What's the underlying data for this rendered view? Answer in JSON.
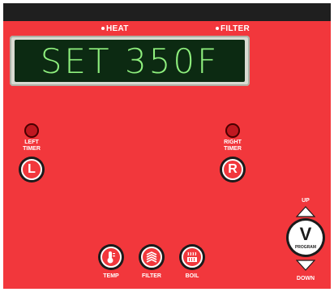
{
  "indicators": {
    "heat": "HEAT",
    "filter": "FILTER"
  },
  "display": {
    "text": "SET 350F"
  },
  "timers": {
    "left": {
      "label_line1": "LEFT",
      "label_line2": "TIMER",
      "button": "L"
    },
    "right": {
      "label_line1": "RIGHT",
      "label_line2": "TIMER",
      "button": "R"
    }
  },
  "bottom_buttons": {
    "temp": "TEMP",
    "filter": "FILTER",
    "boil": "BOIL"
  },
  "program": {
    "up": "UP",
    "logo": "V",
    "program": "PROGRAM",
    "down": "DOWN"
  },
  "icons": [
    "thermometer-icon",
    "filter-icon",
    "boil-icon",
    "up-arrow-icon",
    "down-arrow-icon"
  ],
  "colors": {
    "panel": "#f2373c",
    "display_text": "#8ff07e",
    "display_bg": "#0c2a12"
  }
}
